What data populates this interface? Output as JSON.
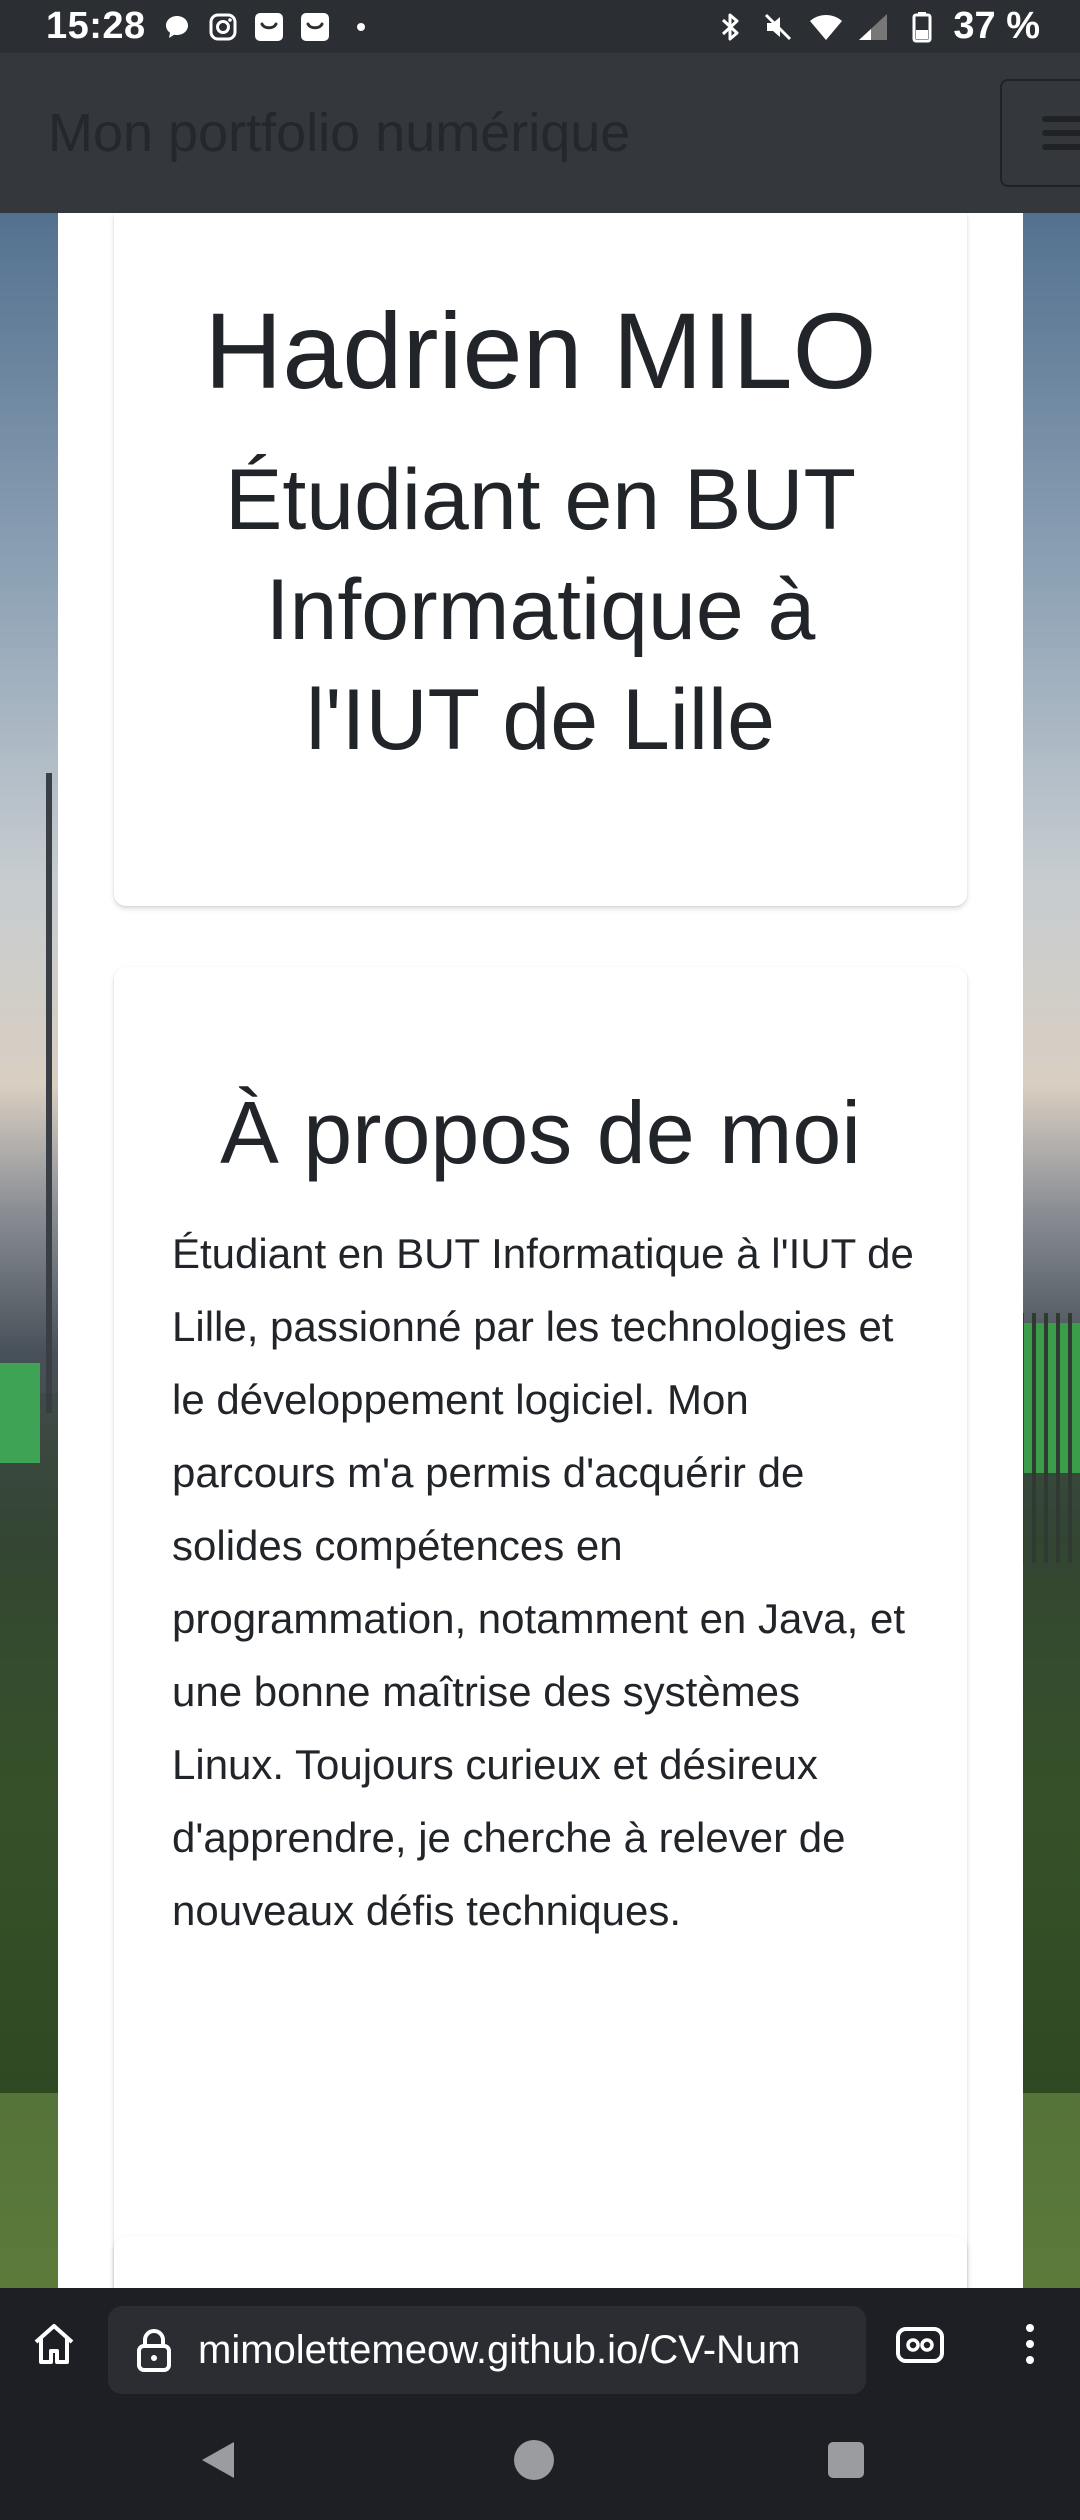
{
  "status_bar": {
    "time": "15:28",
    "left_icons": [
      "chat-bubble-icon",
      "instagram-icon",
      "app-notification-icon",
      "app-notification-icon",
      "dot-icon"
    ],
    "right_icons": [
      "bluetooth-icon",
      "mute-icon",
      "wifi-icon",
      "signal-icon",
      "battery-icon"
    ],
    "battery": "37 %"
  },
  "site_header": {
    "title": "Mon portfolio numérique"
  },
  "hero": {
    "name": "Hadrien MILO",
    "subtitle": "Étudiant en BUT Informatique à l'IUT de Lille"
  },
  "about": {
    "title": "À propos de moi",
    "text": "Étudiant en BUT Informatique à l'IUT de Lille, passionné par les technologies et le développement logiciel. Mon parcours m'a permis d'acquérir de solides compétences en programmation, notamment en Java, et une bonne maîtrise des systèmes Linux. Toujours curieux et désireux d'apprendre, je cherche à relever de nouveaux défis techniques."
  },
  "browser": {
    "url": "mimolettemeow.github.io/CV-Num"
  },
  "colors": {
    "header_bg": "#34373c",
    "text": "#212529",
    "browser_bg": "#1e1f24"
  }
}
